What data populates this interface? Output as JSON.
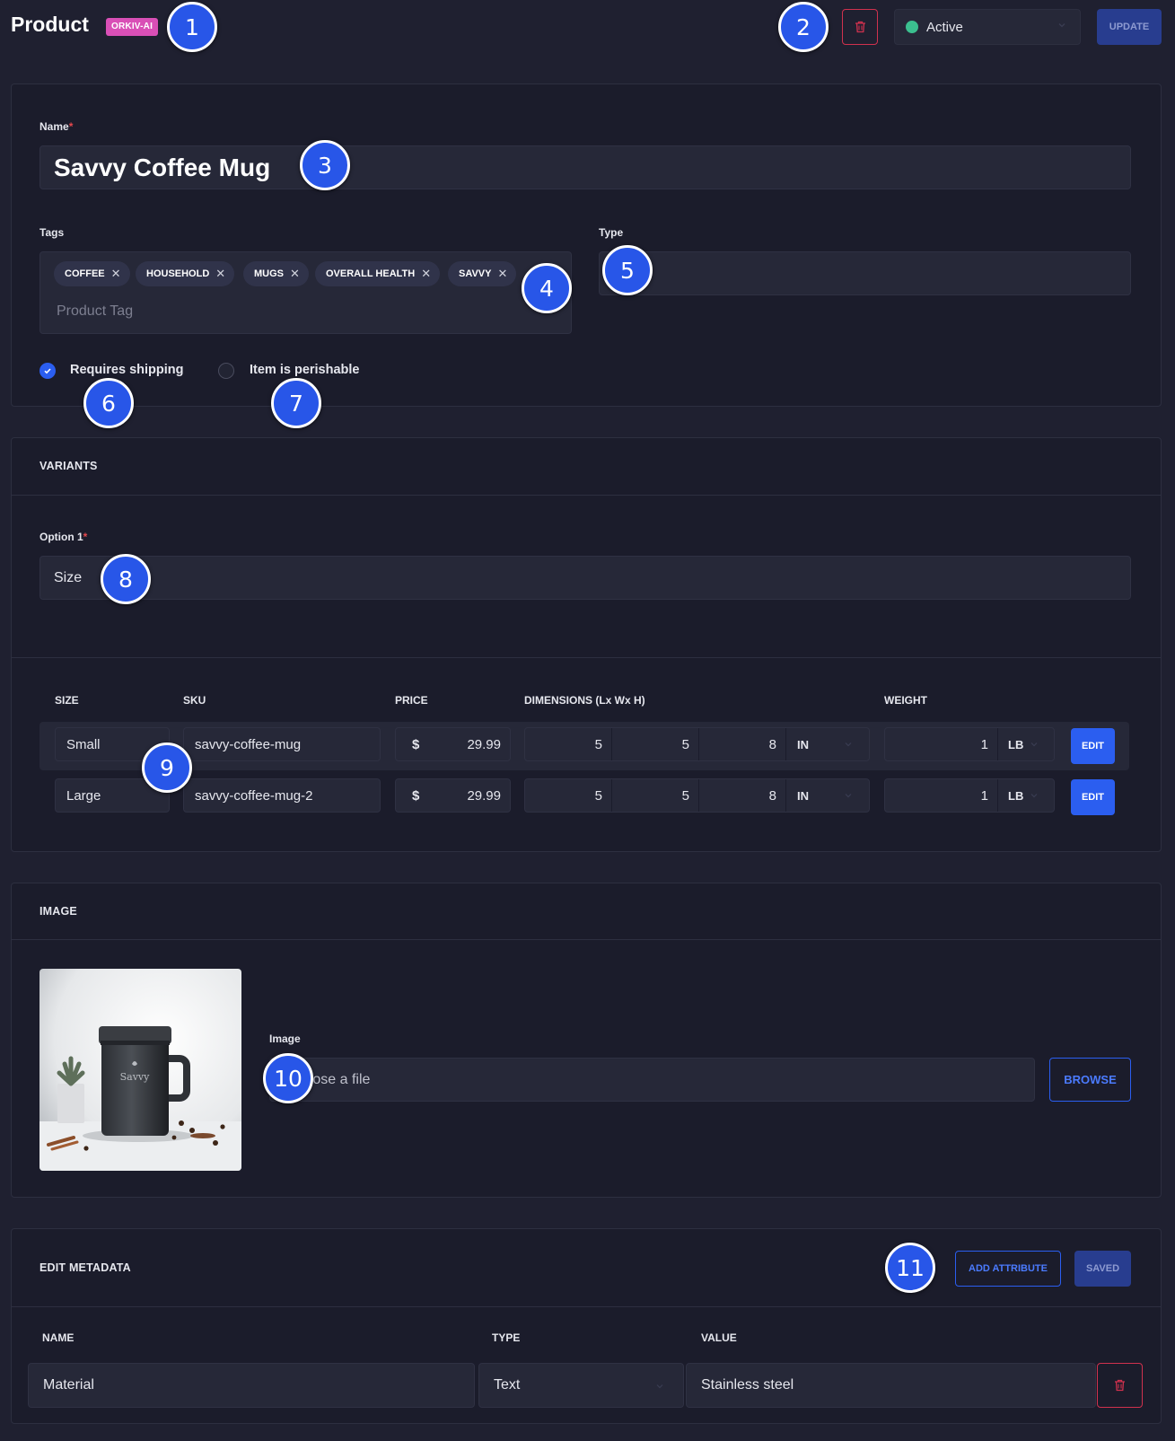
{
  "header": {
    "title": "Product",
    "badge": "ORKIV-AI",
    "delete_icon": "trash-icon",
    "status": {
      "label": "Active",
      "color": "#3bbf8f"
    },
    "update_label": "UPDATE"
  },
  "product": {
    "name_label": "Name",
    "name_required": "*",
    "name_value": "Savvy Coffee Mug",
    "tags_label": "Tags",
    "tags": [
      "COFFEE",
      "HOUSEHOLD",
      "MUGS",
      "OVERALL HEALTH",
      "SAVVY"
    ],
    "tag_placeholder": "Product Tag",
    "type_label": "Type",
    "type_value": "",
    "requires_shipping": {
      "label": "Requires shipping",
      "checked": true
    },
    "perishable": {
      "label": "Item is perishable",
      "checked": false
    }
  },
  "variants": {
    "section_title": "VARIANTS",
    "option_label": "Option 1",
    "option_required": "*",
    "option_value": "Size",
    "columns": [
      "SIZE",
      "SKU",
      "PRICE",
      "DIMENSIONS (Lx Wx H)",
      "WEIGHT"
    ],
    "rows": [
      {
        "size": "Small",
        "sku": "savvy-coffee-mug",
        "currency": "$",
        "price": "29.99",
        "l": "5",
        "w": "5",
        "h": "8",
        "dim_unit": "IN",
        "weight": "1",
        "weight_unit": "LB",
        "edit": "EDIT"
      },
      {
        "size": "Large",
        "sku": "savvy-coffee-mug-2",
        "currency": "$",
        "price": "29.99",
        "l": "5",
        "w": "5",
        "h": "8",
        "dim_unit": "IN",
        "weight": "1",
        "weight_unit": "LB",
        "edit": "EDIT"
      }
    ]
  },
  "image": {
    "section_title": "IMAGE",
    "mug_brand": "Savvy",
    "field_label": "Image",
    "placeholder": "Choose a file",
    "browse_label": "BROWSE"
  },
  "metadata": {
    "section_title": "EDIT METADATA",
    "add_label": "ADD ATTRIBUTE",
    "saved_label": "SAVED",
    "columns": [
      "NAME",
      "TYPE",
      "VALUE"
    ],
    "rows": [
      {
        "name": "Material",
        "type": "Text",
        "value": "Stainless steel"
      }
    ]
  },
  "markers": [
    "1",
    "2",
    "3",
    "4",
    "5",
    "6",
    "7",
    "8",
    "9",
    "10",
    "11"
  ],
  "colors": {
    "background": "#1f2030",
    "card": "#1b1c2b",
    "input": "#262838",
    "accent": "#2b5ef0",
    "danger": "#d0314e",
    "badge": "#d94fb6"
  }
}
